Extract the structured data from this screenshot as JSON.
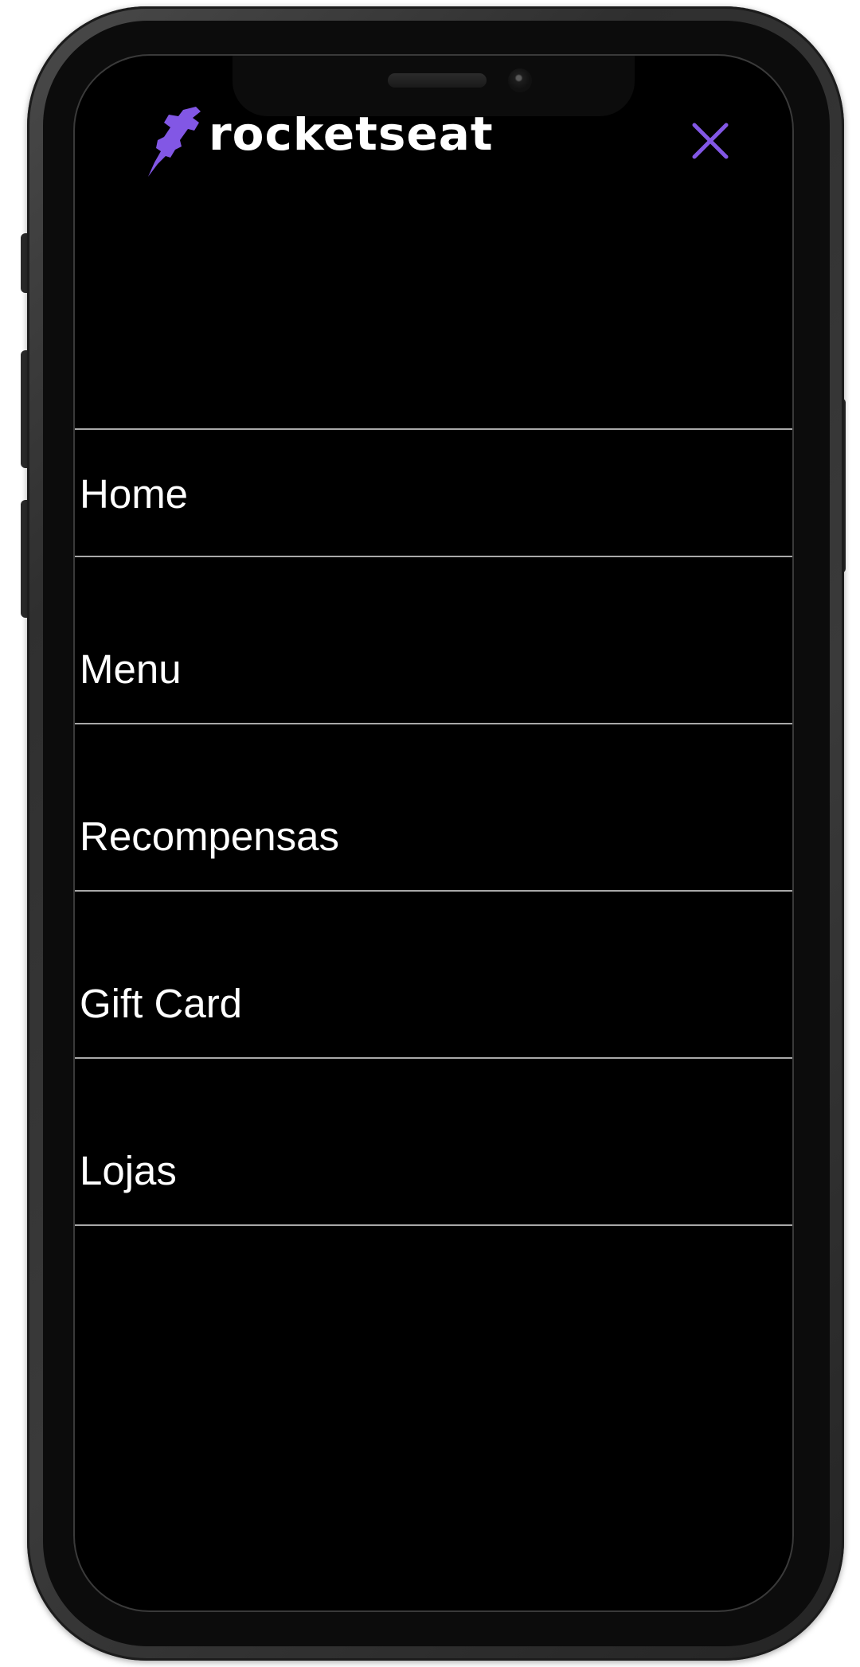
{
  "app": {
    "brand": "rocketseat",
    "accent_color": "#8257e5",
    "background_color": "#000000",
    "text_color": "#ffffff"
  },
  "header": {
    "logo_icon": "rocket-icon",
    "close_icon": "close-icon"
  },
  "menu": {
    "items": [
      {
        "label": "Home"
      },
      {
        "label": "Menu"
      },
      {
        "label": "Recompensas"
      },
      {
        "label": "Gift Card"
      },
      {
        "label": "Lojas"
      }
    ]
  }
}
